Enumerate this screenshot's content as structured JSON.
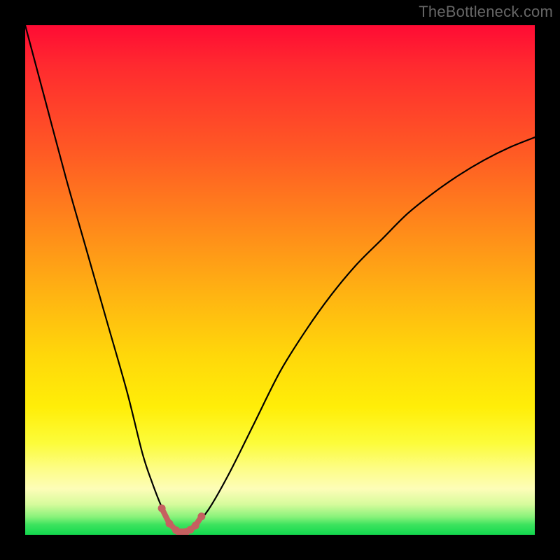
{
  "watermark_text": "TheBottleneck.com",
  "chart_data": {
    "type": "line",
    "title": "",
    "xlabel": "",
    "ylabel": "",
    "xlim": [
      0,
      100
    ],
    "ylim": [
      0,
      100
    ],
    "series": [
      {
        "name": "bottleneck-curve",
        "x": [
          0,
          4,
          8,
          12,
          16,
          20,
          23,
          25,
          27,
          29,
          30,
          31,
          33,
          36,
          40,
          45,
          50,
          55,
          60,
          65,
          70,
          75,
          80,
          85,
          90,
          95,
          100
        ],
        "y": [
          100,
          85,
          70,
          56,
          42,
          28,
          16,
          10,
          5,
          1.5,
          0.5,
          0.5,
          1.5,
          5,
          12,
          22,
          32,
          40,
          47,
          53,
          58,
          63,
          67,
          70.5,
          73.5,
          76,
          78
        ]
      }
    ],
    "markers": {
      "name": "flat-bottom",
      "x": [
        26.8,
        28.3,
        29.6,
        30.2,
        30.8,
        31.6,
        32.4,
        33.4,
        34.6
      ],
      "y": [
        5.2,
        2.2,
        0.9,
        0.5,
        0.5,
        0.6,
        1.0,
        1.8,
        3.6
      ]
    },
    "gradient_stops": [
      {
        "pos": 0,
        "color": "#ff0b34"
      },
      {
        "pos": 0.25,
        "color": "#ff5a24"
      },
      {
        "pos": 0.53,
        "color": "#ffb412"
      },
      {
        "pos": 0.75,
        "color": "#ffee08"
      },
      {
        "pos": 0.91,
        "color": "#fdfdb8"
      },
      {
        "pos": 1.0,
        "color": "#12d84e"
      }
    ]
  }
}
